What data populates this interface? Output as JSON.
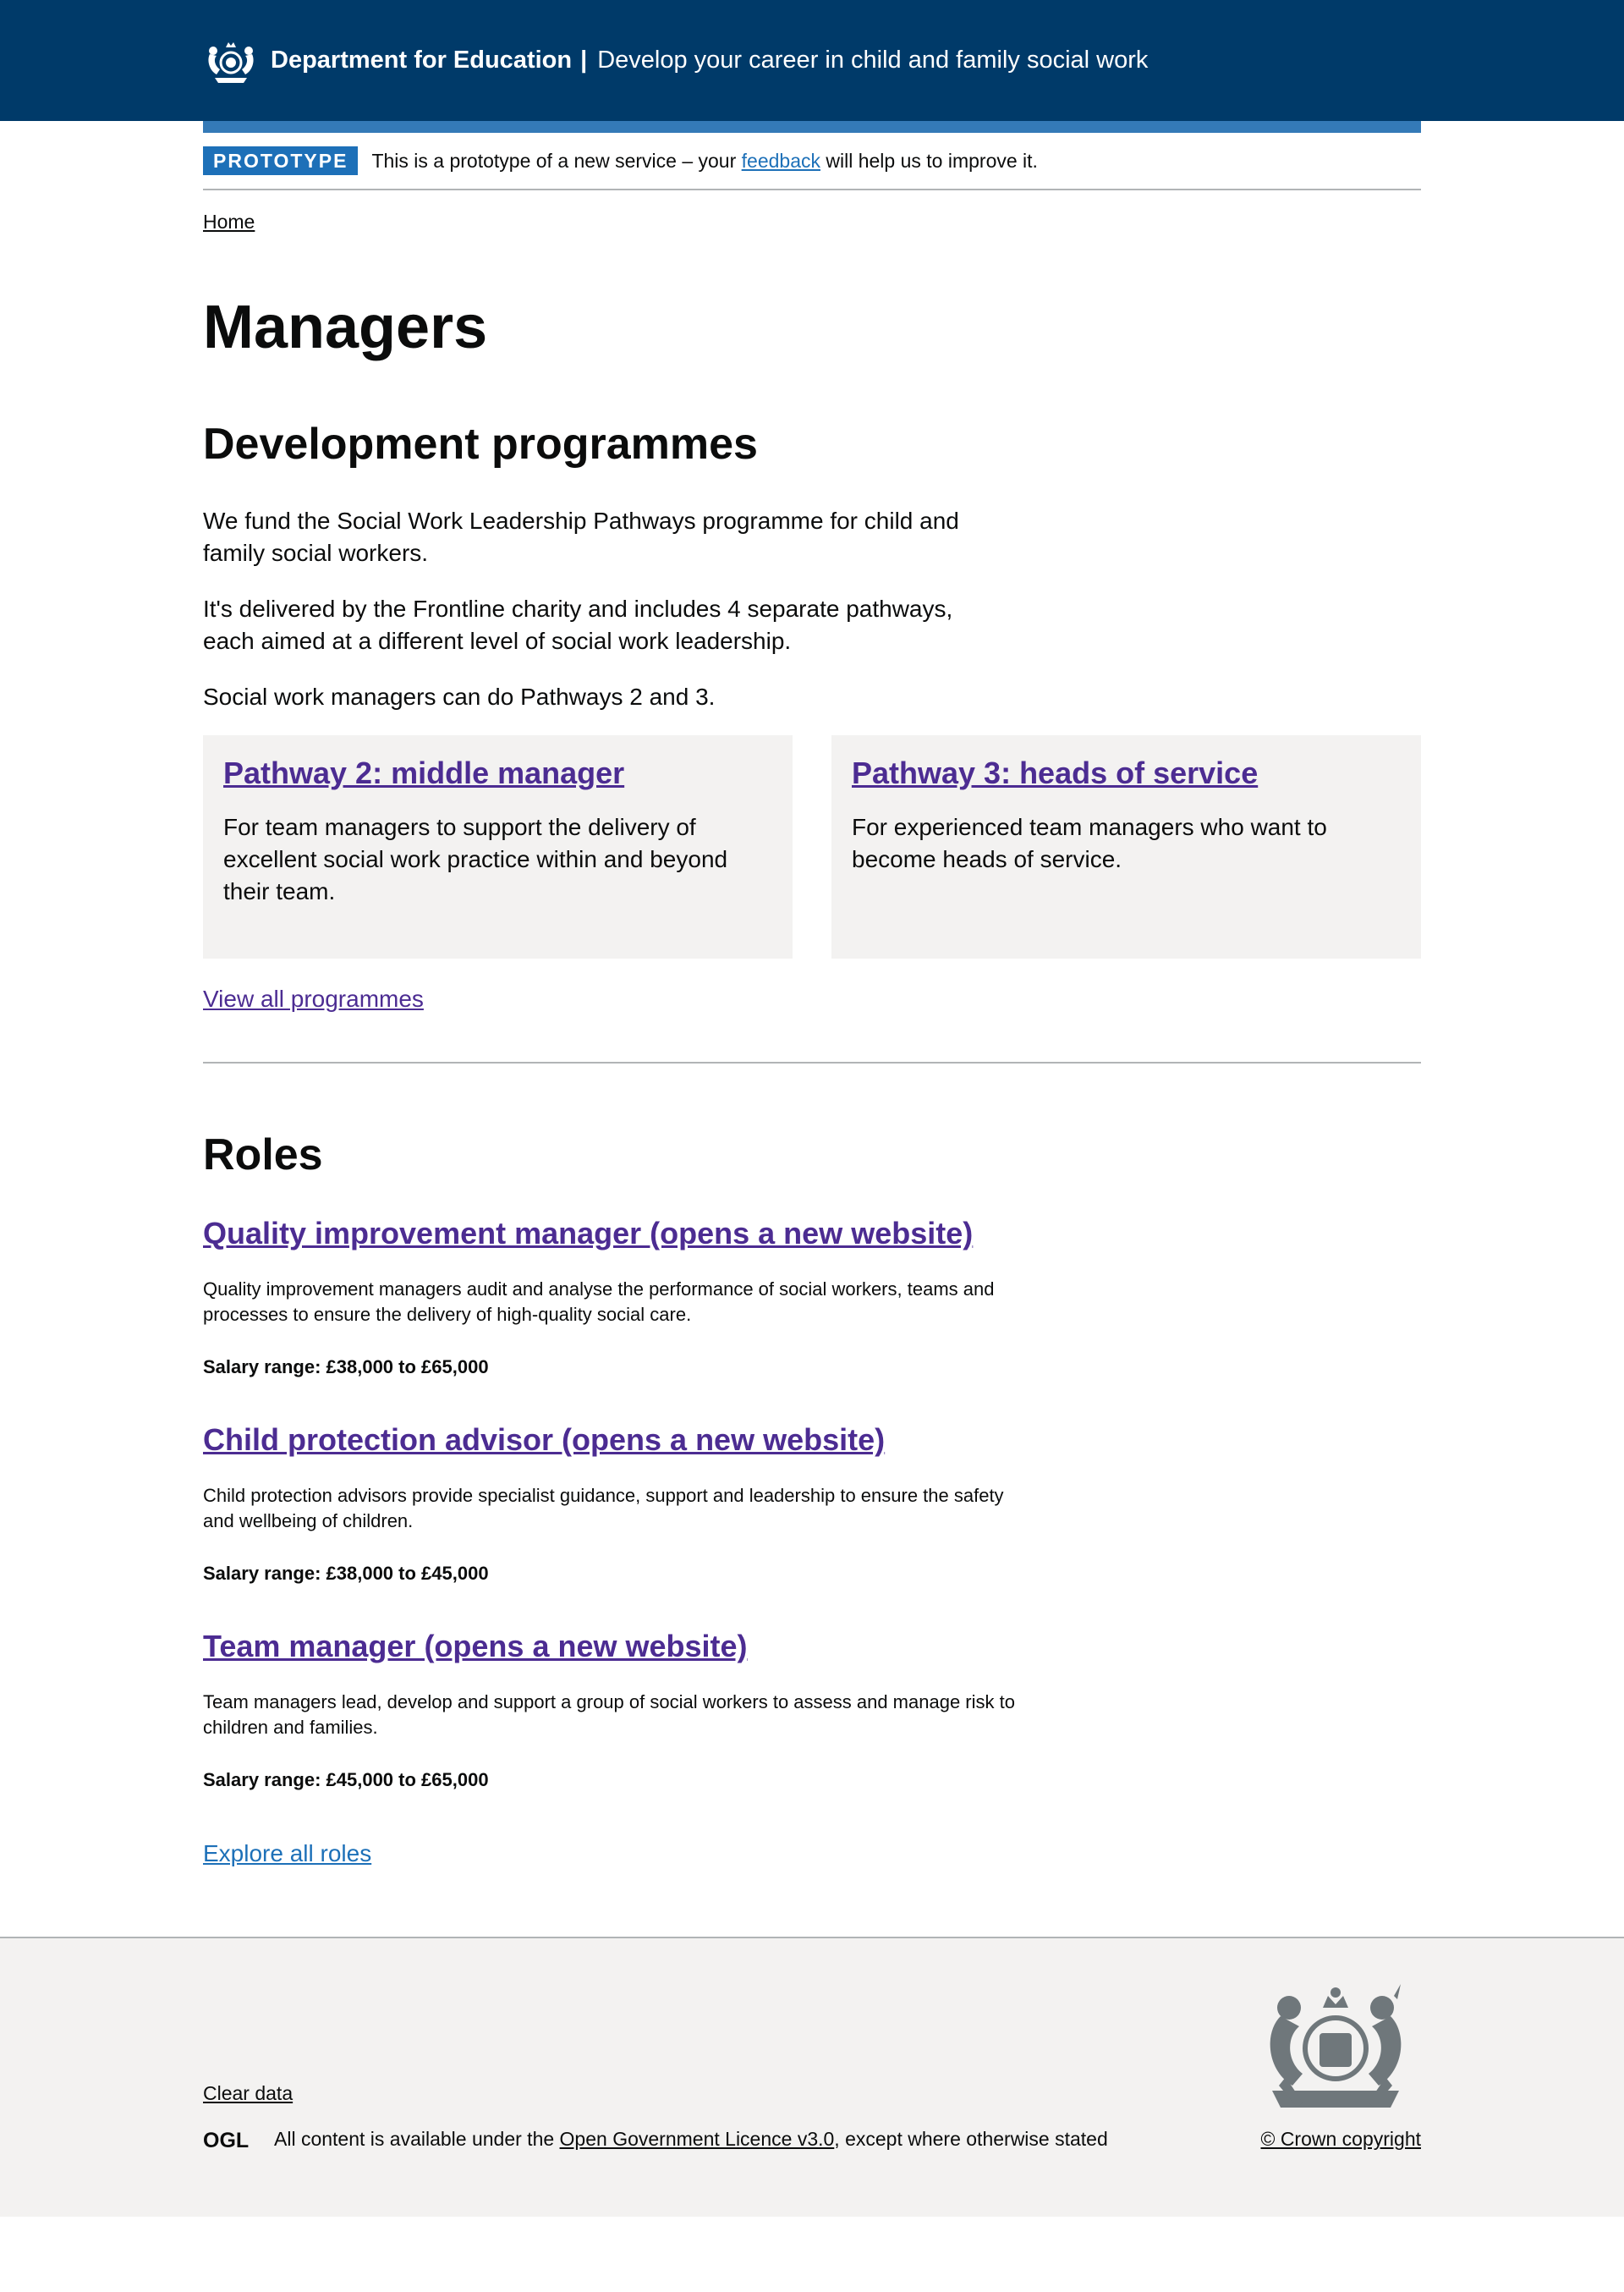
{
  "header": {
    "org_name": "Department for Education",
    "separator": "|",
    "service_name": "Develop your career in child and family social work"
  },
  "phase_banner": {
    "tag": "PROTOTYPE",
    "text_before": "This is a prototype of a new service – your",
    "link": "feedback",
    "text_after": "will help us to improve it."
  },
  "breadcrumb": {
    "home": "Home"
  },
  "page": {
    "title": "Managers"
  },
  "development": {
    "title": "Development programmes",
    "paragraphs": [
      "We fund the Social Work Leadership Pathways programme for child and family social workers.",
      "It's delivered by the Frontline charity and includes 4 separate pathways, each aimed at a different level of social work leadership.",
      "Social work managers can do Pathways 2 and 3."
    ],
    "cards": [
      {
        "title": "Pathway 2: middle manager",
        "description": "For team managers to support the delivery of excellent social work practice within and beyond their team."
      },
      {
        "title": "Pathway 3: heads of service",
        "description": "For experienced team managers who want to become heads of service."
      }
    ],
    "view_all": "View all programmes"
  },
  "roles": {
    "title": "Roles",
    "items": [
      {
        "title": "Quality improvement manager (opens a new website)",
        "description": "Quality improvement managers audit and analyse the performance of social workers, teams and processes to ensure the delivery of high-quality social care.",
        "salary": "Salary range: £38,000 to £65,000"
      },
      {
        "title": "Child protection advisor (opens a new website)",
        "description": "Child protection advisors provide specialist guidance, support and leadership to ensure the safety and wellbeing of children.",
        "salary": "Salary range: £38,000 to £45,000"
      },
      {
        "title": "Team manager (opens a new website)",
        "description": "Team managers lead, develop and support a group of social workers to assess and manage risk to children and families.",
        "salary": "Salary range: £45,000 to £65,000"
      }
    ],
    "explore_all": "Explore all roles"
  },
  "footer": {
    "clear_data": "Clear data",
    "ogl": "OGL",
    "licence_before": "All content is available under the",
    "licence_link": "Open Government Licence v3.0",
    "licence_after": ", except where otherwise stated",
    "copyright": "© Crown copyright"
  },
  "colors": {
    "header_bg": "#003a69",
    "accent_bar": "#347ab7",
    "link_blue": "#1d70b8",
    "link_visited_purple": "#4c2c92",
    "card_bg": "#f3f2f1"
  }
}
